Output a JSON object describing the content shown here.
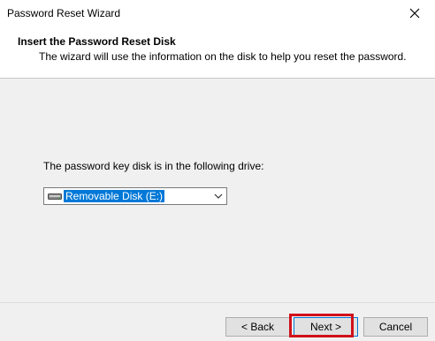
{
  "window": {
    "title": "Password Reset Wizard",
    "close_icon": "close-icon"
  },
  "header": {
    "title": "Insert the Password Reset Disk",
    "subtitle": "The wizard will use the information on the disk to help you reset the password."
  },
  "content": {
    "drive_label": "The password key disk is in the following drive:",
    "drive_select": {
      "selected": "Removable Disk (E:)",
      "icon": "removable-disk-icon"
    }
  },
  "buttons": {
    "back": "< Back",
    "next": "Next >",
    "cancel": "Cancel"
  },
  "colors": {
    "highlight": "#d0101a",
    "selection": "#0078d7"
  }
}
